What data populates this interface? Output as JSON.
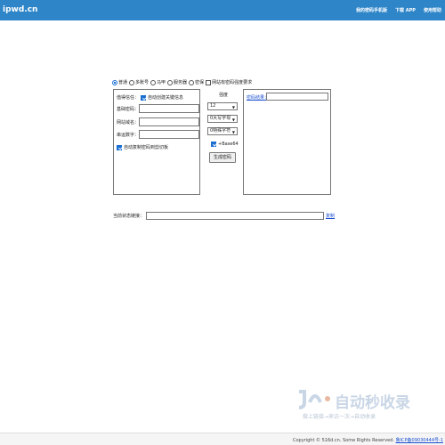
{
  "header": {
    "logo": "ipwd.cn",
    "nav": [
      "我的密码手机版",
      "下载 APP",
      "使用帮助"
    ]
  },
  "modes": {
    "options": [
      "普通",
      "多账号",
      "马甲",
      "服务器",
      "密保"
    ],
    "selected": "普通",
    "checkbox_label": "网站有密码强度要求"
  },
  "left_panel": {
    "memory_label": "值得信任：",
    "memory_check_label": "自动创建关键信息",
    "fields": [
      {
        "label": "基础密码："
      },
      {
        "label": "网站域名："
      },
      {
        "label": "串运数字："
      }
    ],
    "auto_copy_label": "自动复制密码到剪切板"
  },
  "middle": {
    "length_label": "强度",
    "selects": [
      "12",
      "0大写字母",
      "0特殊字符"
    ],
    "base64_label": "+Base64",
    "generate_button": "生成密码"
  },
  "right_panel": {
    "result_label": "密码结果："
  },
  "link_row": {
    "label": "当前状态链接：",
    "copy_link": "复制"
  },
  "watermark": {
    "title": "自动秒收录",
    "subtitle": "做上链接→来访一次→自动收录"
  },
  "footer": {
    "copyright": "Copyright © 516d.cn. Some Rights Reserved.",
    "icp": "鲁ICP备09030444号-1"
  },
  "colors": {
    "topbar": "#2e86c9",
    "link": "#1a4fd1",
    "checked": "#1a6fd1"
  }
}
